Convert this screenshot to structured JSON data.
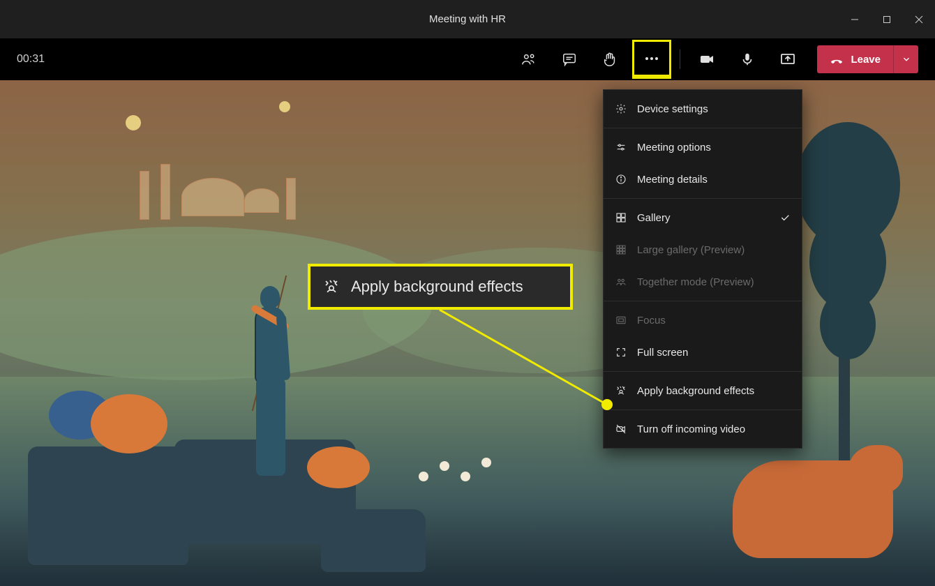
{
  "window": {
    "title": "Meeting with HR"
  },
  "toolbar": {
    "timer": "00:31",
    "leave_label": "Leave"
  },
  "menu": {
    "device_settings": "Device settings",
    "meeting_options": "Meeting options",
    "meeting_details": "Meeting details",
    "gallery": "Gallery",
    "large_gallery": "Large gallery (Preview)",
    "together_mode": "Together mode (Preview)",
    "focus": "Focus",
    "full_screen": "Full screen",
    "apply_background": "Apply background effects",
    "turn_off_incoming": "Turn off incoming video"
  },
  "callout": {
    "label": "Apply background effects"
  }
}
